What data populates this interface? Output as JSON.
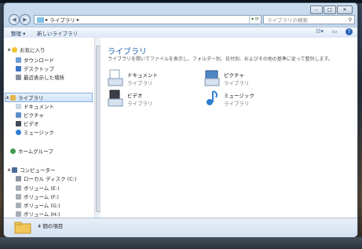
{
  "window": {
    "caption_buttons": [
      "minimize",
      "maximize",
      "close"
    ]
  },
  "navigation": {
    "back_icon": "back-arrow-icon",
    "forward_icon": "forward-arrow-icon",
    "address": {
      "path_label": "ライブラリ",
      "separator": "▸"
    },
    "search_placeholder": "ライブラリの検索"
  },
  "command_bar": {
    "organize_label": "整理 ▾",
    "new_library_label": "新しいライブラリ"
  },
  "sidebar": {
    "favorites": {
      "label": "お気に入り",
      "items": [
        "ダウンロード",
        "デスクトップ",
        "最近表示した場所"
      ]
    },
    "libraries": {
      "label": "ライブラリ",
      "items": [
        "ドキュメント",
        "ピクチャ",
        "ビデオ",
        "ミュージック"
      ]
    },
    "homegroup": {
      "label": "ホームグループ"
    },
    "computer": {
      "label": "コンピューター",
      "items": [
        "ローカル ディスク (C:)",
        "ボリューム (E:)",
        "ボリューム (F:)",
        "ボリューム (G:)",
        "ボリューム (H:)"
      ]
    }
  },
  "main": {
    "title": "ライブラリ",
    "description": "ライブラリを開いてファイルを表示し、フォルダー別、日付別、およびその他の基準に従って整列します。",
    "tiles": [
      {
        "name": "ドキュメント",
        "sub": "ライブラリ",
        "icon": "documents-library-icon"
      },
      {
        "name": "ピクチャ",
        "sub": "ライブラリ",
        "icon": "pictures-library-icon"
      },
      {
        "name": "ビデオ",
        "sub": "ライブラリ",
        "icon": "videos-library-icon"
      },
      {
        "name": "ミュージック",
        "sub": "ライブラリ",
        "icon": "music-library-icon"
      }
    ]
  },
  "details": {
    "count_text": "4 個の項目"
  },
  "colors": {
    "accent": "#1e5fa8",
    "selection": "#cfe4fa"
  }
}
